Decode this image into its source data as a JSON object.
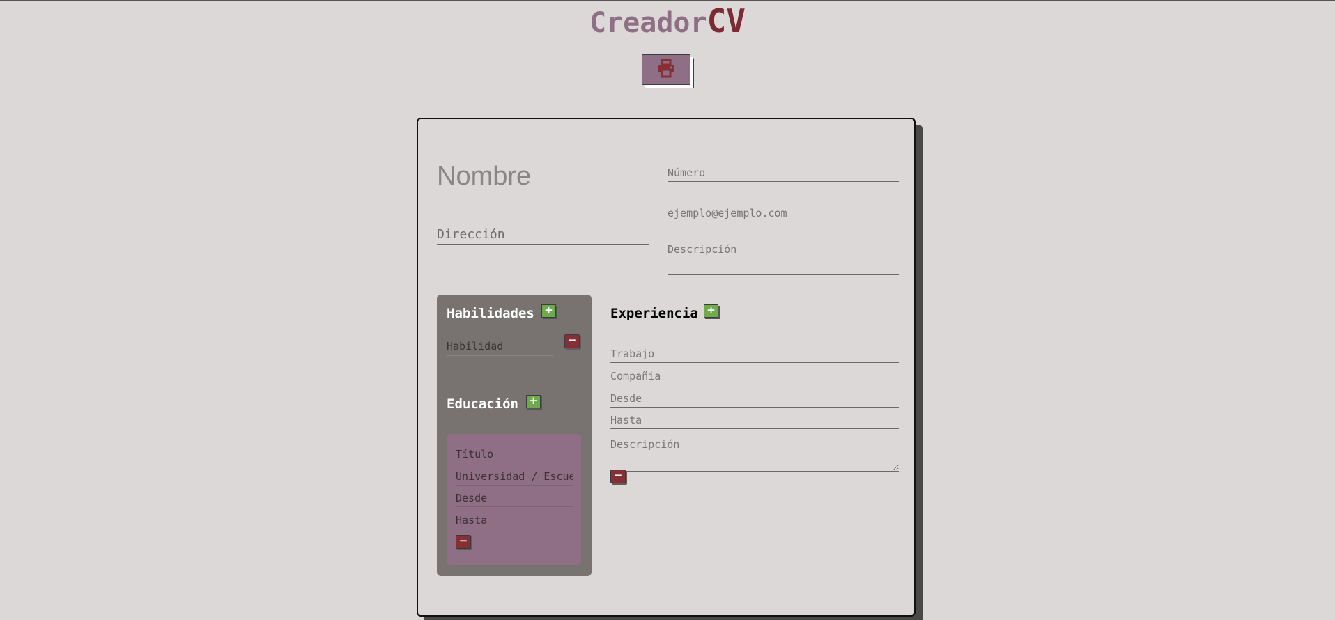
{
  "header": {
    "title_part1": "Creador",
    "title_part2": "CV",
    "print_icon": "printer-icon"
  },
  "colors": {
    "background": "#dcd8d7",
    "accent_purple": "#8e6f86",
    "accent_red": "#7c2b33",
    "sidebar_gray": "#787370",
    "add_green": "#6eab4c",
    "remove_red": "#862f35"
  },
  "personal": {
    "name_placeholder": "Nombre",
    "address_placeholder": "Dirección",
    "phone_placeholder": "Número",
    "email_placeholder": "ejemplo@ejemplo.com",
    "description_placeholder": "Descripción"
  },
  "skills": {
    "title": "Habilidades",
    "add_label": "+",
    "remove_label": "−",
    "item_placeholder": "Habilidad"
  },
  "education": {
    "title": "Educación",
    "add_label": "+",
    "remove_label": "−",
    "degree_placeholder": "Título",
    "school_placeholder": "Universidad / Escuela",
    "from_placeholder": "Desde",
    "to_placeholder": "Hasta"
  },
  "experience": {
    "title": "Experiencia",
    "add_label": "+",
    "remove_label": "−",
    "job_placeholder": "Trabajo",
    "company_placeholder": "Compañia",
    "from_placeholder": "Desde",
    "to_placeholder": "Hasta",
    "description_placeholder": "Descripción"
  }
}
